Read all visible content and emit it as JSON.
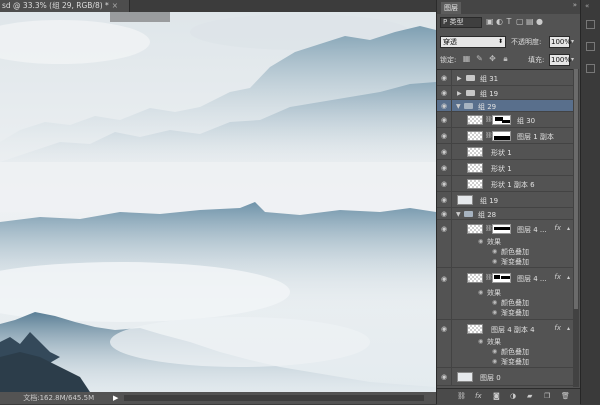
{
  "document_tab": {
    "title": "sd @ 33.3% (组 29, RGB/8) *",
    "close": "×"
  },
  "status_bar": {
    "zoom": "",
    "doc_size": "文档:162.8M/645.5M",
    "arrow": "▶"
  },
  "layers_panel": {
    "title": "图层",
    "collapse": "»",
    "filter_kind": "P 类型",
    "blend_mode": "穿透",
    "opacity_label": "不透明度:",
    "opacity_value": "100%",
    "lock_label": "锁定:",
    "fill_label": "填充:",
    "fill_value": "100%",
    "layers": [
      {
        "name": "组 31",
        "type": "group",
        "expanded": false,
        "selected": false
      },
      {
        "name": "组 19",
        "type": "group",
        "expanded": false,
        "selected": false
      },
      {
        "name": "组 29",
        "type": "group",
        "expanded": true,
        "selected": true
      },
      {
        "name": "组 30",
        "type": "masked"
      },
      {
        "name": "图层 1 副本",
        "type": "masked"
      },
      {
        "name": "形状 1",
        "type": "pixel"
      },
      {
        "name": "形状 1",
        "type": "pixel"
      },
      {
        "name": "形状 1 副本 6",
        "type": "pixel"
      },
      {
        "name": "组 19",
        "type": "pixel-plain"
      },
      {
        "name": "组 28",
        "type": "group",
        "expanded": true
      },
      {
        "name": "图层 4 ...",
        "type": "masked-fx",
        "effects_label": "效果",
        "effects": [
          "颜色叠加",
          "渐变叠加"
        ]
      },
      {
        "name": "图层 4 ...",
        "type": "masked-fx",
        "effects_label": "效果",
        "effects": [
          "颜色叠加",
          "渐变叠加"
        ]
      },
      {
        "name": "图层 4 副本 4",
        "type": "pixel-fx",
        "effects_label": "效果",
        "effects": [
          "颜色叠加",
          "渐变叠加"
        ]
      },
      {
        "name": "图层 0",
        "type": "pixel-plain"
      }
    ],
    "fx_label": "fx",
    "footer_icons": [
      "link-icon",
      "fx-icon",
      "mask-icon",
      "adjustment-icon",
      "folder-icon",
      "new-layer-icon",
      "trash-icon"
    ]
  },
  "colors": {
    "panel_bg": "#535353",
    "selected": "#596f8c",
    "canvas_sky": "#e9eef1",
    "mountain": "#5c7f96"
  }
}
